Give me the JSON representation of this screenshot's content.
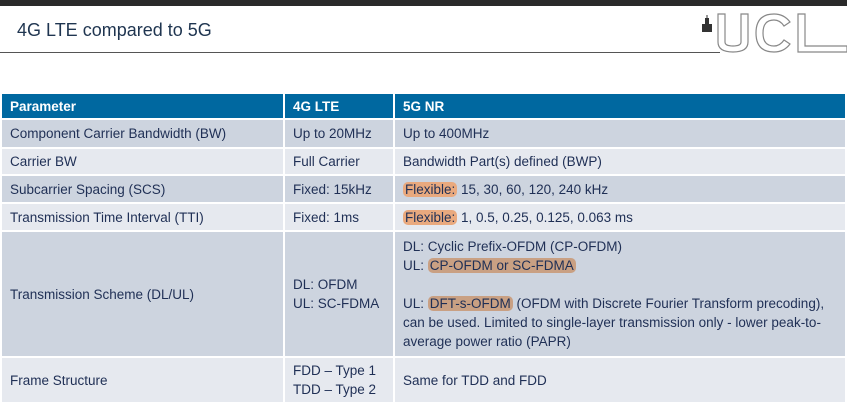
{
  "header": {
    "title": "4G LTE compared to 5G",
    "logo_text": "UCL"
  },
  "table": {
    "columns": [
      "Parameter",
      "4G LTE",
      "5G NR"
    ],
    "rows": [
      {
        "param": "Component Carrier Bandwidth (BW)",
        "lte": "Up to 20MHz",
        "nr": "Up to 400MHz"
      },
      {
        "param": "Carrier BW",
        "lte": "Full Carrier",
        "nr": "Bandwidth Part(s) defined (BWP)"
      },
      {
        "param": "Subcarrier Spacing (SCS)",
        "lte": "Fixed: 15kHz",
        "nr_highlight": "Flexible:",
        "nr": " 15, 30, 60, 120, 240 kHz"
      },
      {
        "param": "Transmission Time Interval (TTI)",
        "lte": "Fixed: 1ms",
        "nr_highlight": "Flexible:",
        "nr": " 1, 0.5, 0.25, 0.125, 0.063 ms"
      },
      {
        "param": "Transmission Scheme (DL/UL)",
        "lte_lines": [
          "DL: OFDM",
          "UL: SC-FDMA"
        ],
        "nr_dl": "DL: Cyclic Prefix-OFDM (CP-OFDM)",
        "nr_ul_prefix": "UL: ",
        "nr_ul_highlight": "CP-OFDM or SC-FDMA",
        "nr_ul2_prefix": "UL: ",
        "nr_ul2_highlight": "DFT-s-OFDM",
        "nr_ul2_rest": " (OFDM with Discrete Fourier Transform precoding), can be used. Limited to single-layer transmission only - lower peak-to-average power ratio (PAPR)"
      },
      {
        "param": "Frame Structure",
        "lte_lines": [
          "FDD – Type 1",
          "TDD – Type 2"
        ],
        "nr": "Same for TDD and FDD"
      }
    ]
  },
  "colors": {
    "header_bg": "#0068a0",
    "row_dark": "#cdd4df",
    "row_light": "#e6e9ef",
    "highlight_light": "#e9a97e",
    "highlight_dark": "#c9a083"
  }
}
